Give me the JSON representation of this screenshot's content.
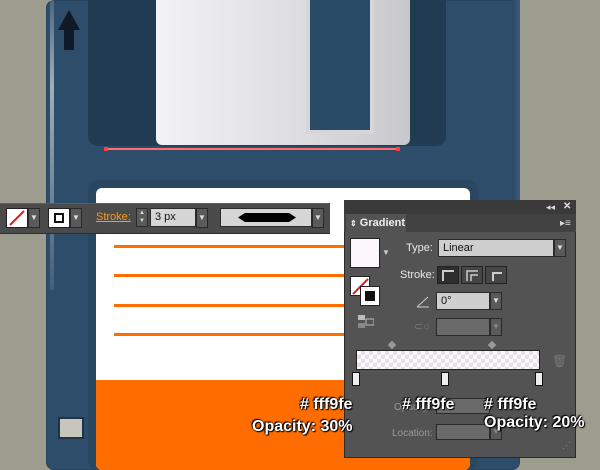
{
  "control_bar": {
    "stroke_label": "Stroke:",
    "stroke_weight": "3 px"
  },
  "gradient_panel": {
    "title": "Gradient",
    "type_label": "Type:",
    "type_value": "Linear",
    "stroke_label": "Stroke:",
    "angle_value": "0°",
    "opacity_label": "Opacity:",
    "location_label": "Location:"
  },
  "annotations": {
    "stop1_color": "# fff9fe",
    "stop1_opacity": "Opacity: 30%",
    "stop2_color": "# fff9fe",
    "stop3_color": "# fff9fe",
    "stop3_opacity": "Opacity: 20%"
  },
  "colors": {
    "disk_body": "#2e4d6b",
    "label_orange": "#ff6c00",
    "accent_stroke_link": "#ff9a1a",
    "gradient_stop_color": "#fff9fe"
  },
  "icons": [
    "arrow-up-icon",
    "none-fill-icon",
    "stroke-swatch-icon",
    "chevron-down-icon",
    "gradient-swatch-icon",
    "trash-icon",
    "panel-menu-icon",
    "collapse-icon",
    "close-icon",
    "angle-icon",
    "aspect-ratio-icon",
    "fill-stroke-toggle-icon",
    "stroke-within-icon",
    "stroke-along-icon",
    "stroke-across-icon"
  ]
}
